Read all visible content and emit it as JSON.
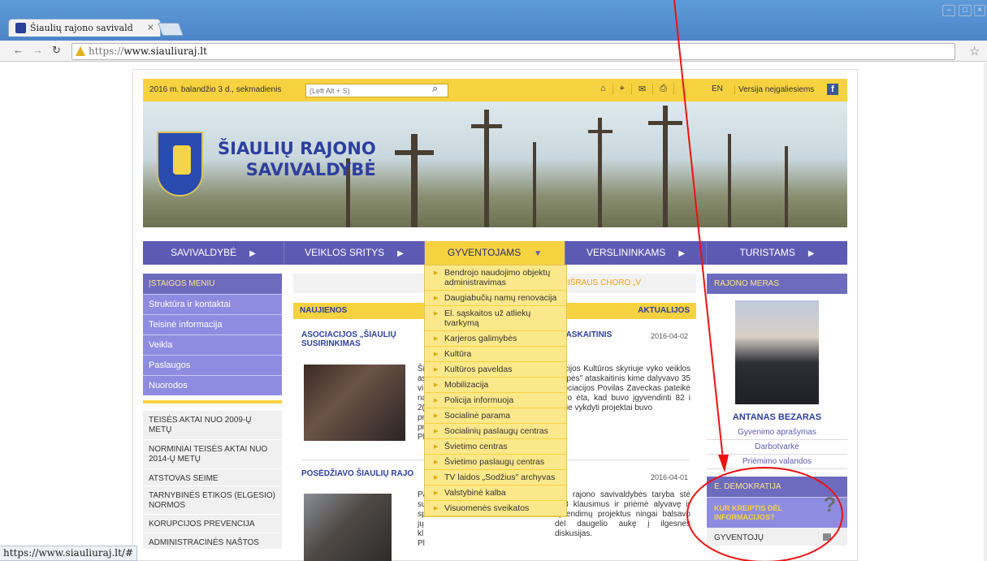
{
  "browser": {
    "tab_title": "Šiaulių rajono savivald",
    "tab_close": "×",
    "url_scheme": "https://",
    "url_host": "www.siauliuraj.lt",
    "status_url": "https://www.siauliuraj.lt/#"
  },
  "topbar": {
    "date": "2016 m. balandžio 3 d., sekmadienis",
    "search_placeholder": "(Left Alt + S)",
    "en_label": "EN",
    "accessible_label": "Versija neįgaliesiems",
    "fb_label": "f"
  },
  "brand": {
    "line1": "ŠIAULIŲ RAJONO",
    "line2": "SAVIVALDYBĖ"
  },
  "banner": {
    "slides_indicator": "●●●●●"
  },
  "nav": [
    {
      "label": "SAVIVALDYBĖ",
      "arrow": "▶"
    },
    {
      "label": "VEIKLOS SRITYS",
      "arrow": "▶"
    },
    {
      "label": "GYVENTOJAMS",
      "arrow": "▼"
    },
    {
      "label": "VERSLININKAMS",
      "arrow": "▶"
    },
    {
      "label": "TURISTAMS",
      "arrow": "▶"
    }
  ],
  "dropdown": [
    "Bendrojo naudojimo objektų administravimas",
    "Daugiabučių namų renovacija",
    "El. sąskaitos už atliekų tvarkymą",
    "Karjeros galimybės",
    "Kultūra",
    "Kultūros paveldas",
    "Mobilizacija",
    "Policija informuoja",
    "Socialinė parama",
    "Socialinių paslaugų centras",
    "Švietimo centras",
    "Švietimo paslaugų centras",
    "TV laidos „Sodžius\" archyvas",
    "Valstybinė kalba",
    "Visuomenės sveikatos"
  ],
  "left": {
    "header": "ĮSTAIGOS MENIU",
    "items": [
      "Struktūra ir kontaktai",
      "Teisinė informacija",
      "Veikla",
      "Paslaugos",
      "Nuorodos"
    ],
    "links": [
      "TEISĖS AKTAI NUO 2009-Ų METŲ",
      "NORMINIAI TEISĖS AKTAI NUO 2014-Ų METŲ",
      "ATSTOVAS SEIME",
      "TARNYBINĖS ETIKOS (ELGESIO) NORMOS",
      "KORUPCIJOS PREVENCIJA",
      "ADMINISTRACINĖS NAŠTOS"
    ]
  },
  "center": {
    "ticker": "20                                    JAUNIMO MIŠRAUS CHORO „V",
    "news_label": "NAUJIENOS",
    "actual_label": "AKTUALIJOS",
    "news1": {
      "title_left": "ASOCIACIJOS „ŠIAULIŲ SUSIRINKIMAS",
      "title_right": "\"ATASKAITINIS",
      "date": "2016-04-02",
      "text_left": "Ši\nas\nvi\nna\n2(\npr\npr\nPl",
      "text_right": "tracijos Kultūros skyriuje vyko veiklos grupės\" ataskaitinis kime dalyvavo 35 asociacijos Povilas Zaveckas pateikė savo ėta, kad buvo įgyvendinti 82 i kurie vykdyti projektai buvo"
    },
    "news2": {
      "title_left": "POSĖDŽIAVO ŠIAULIŲ RAJO",
      "date": "2016-04-01",
      "text_left": "Pa\nsu\nsp\njų\nkl\nPl",
      "text_right": "ulių rajono savivaldybės taryba stė 103 klausimus ir priėmė alyvavę ir sprendimų projektus ningai balsavo dėl daugelio aukę į ilgesnes diskusijas."
    }
  },
  "right": {
    "header": "RAJONO MERAS",
    "mayor_name": "ANTANAS BEZARAS",
    "links": [
      "Gyvenimo aprašymas",
      "Darbotvarkė",
      "Priėmimo valandos"
    ],
    "edem_header": "E. DEMOKRATIJA",
    "kur_label": "KUR KREIPTIS DĖL INFORMACIJOS?",
    "kur_icon": "?",
    "gyv_label": "GYVENTOJŲ"
  },
  "colors": {
    "yellow": "#f7d240",
    "purple": "#5d5ab3",
    "light_purple": "#8d8ce0",
    "annotation_red": "#ee1111"
  }
}
